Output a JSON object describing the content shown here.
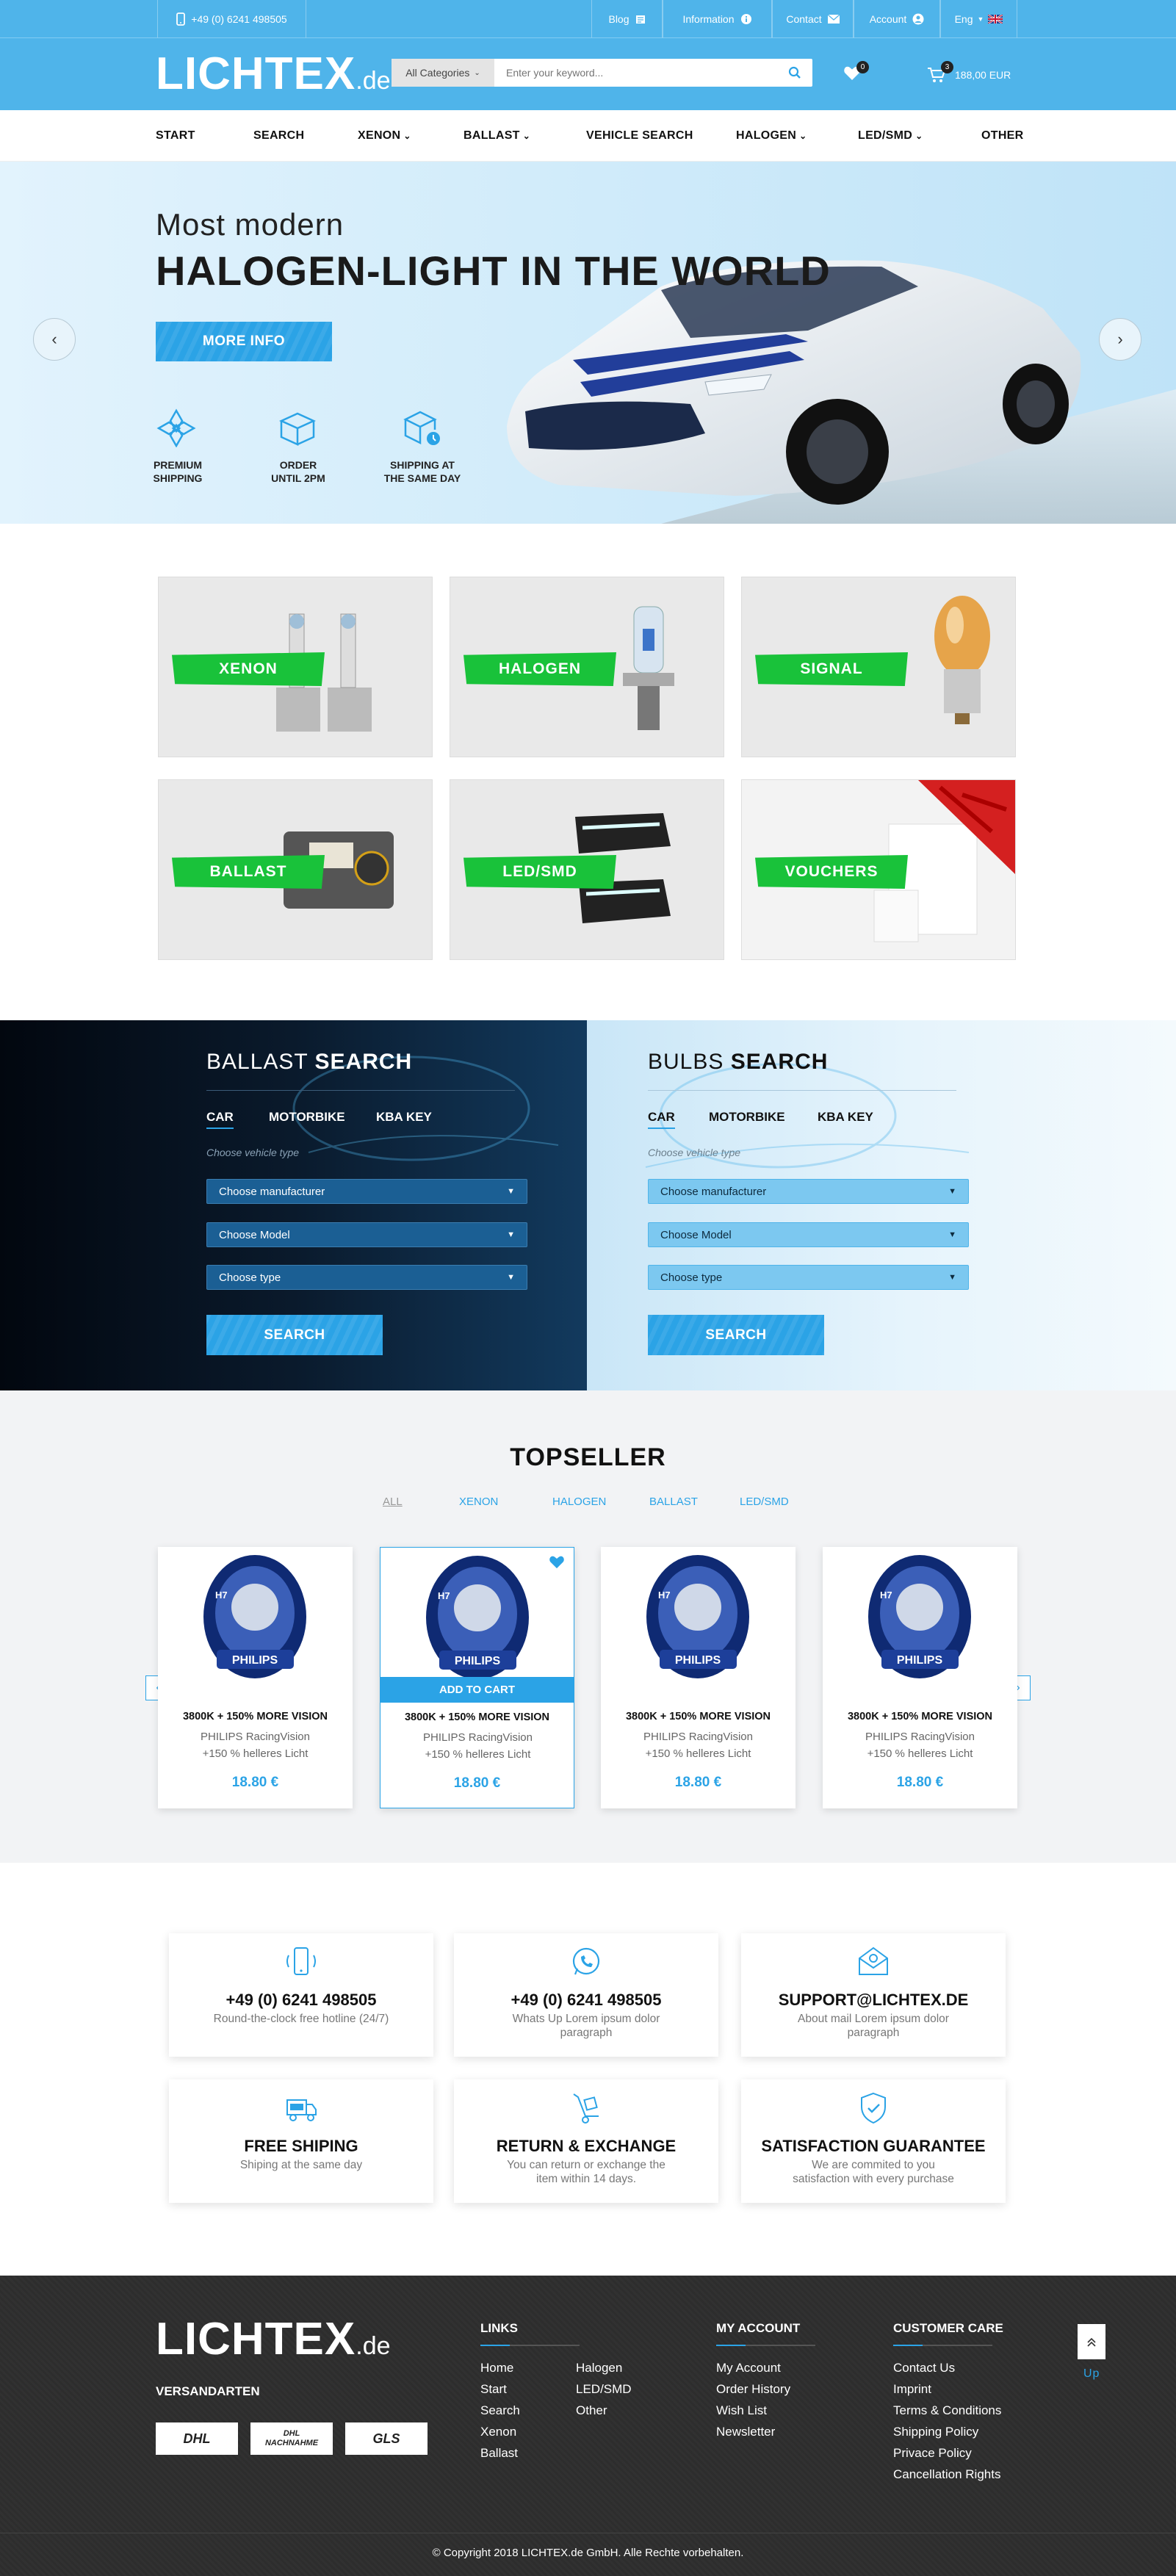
{
  "topbar": {
    "phone": "+49 (0) 6241 498505",
    "blog": "Blog",
    "information": "Information",
    "contact": "Contact",
    "account": "Account",
    "language": "Eng"
  },
  "header": {
    "logo_main": "LICHTEX",
    "logo_suffix": ".de",
    "category": "All Categories",
    "search_placeholder": "Enter your keyword...",
    "wishlist_count": "0",
    "cart_count": "3",
    "cart_total": "188,00 EUR"
  },
  "nav": [
    "START",
    "SEARCH",
    "XENON",
    "BALLAST",
    "VEHICLE SEARCH",
    "HALOGEN",
    "LED/SMD",
    "OTHER"
  ],
  "hero": {
    "line1": "Most modern",
    "line2": "HALOGEN-LIGHT IN THE WORLD",
    "button": "MORE INFO",
    "features": [
      {
        "l1": "PREMIUM",
        "l2": "SHIPPING"
      },
      {
        "l1": "ORDER",
        "l2": "UNTIL 2PM"
      },
      {
        "l1": "SHIPPING AT",
        "l2": "THE SAME DAY"
      }
    ]
  },
  "categories": [
    "XENON",
    "HALOGEN",
    "SIGNAL",
    "BALLAST",
    "LED/SMD",
    "VOUCHERS"
  ],
  "ballast_search": {
    "title_light": "BALLAST",
    "title_bold": "SEARCH",
    "tabs": [
      "CAR",
      "MOTORBIKE",
      "KBA KEY"
    ],
    "hint": "Choose vehicle type",
    "selects": [
      "Choose manufacturer",
      "Choose Model",
      "Choose type"
    ],
    "button": "SEARCH"
  },
  "bulbs_search": {
    "title_light": "BULBS",
    "title_bold": "SEARCH",
    "tabs": [
      "CAR",
      "MOTORBIKE",
      "KBA KEY"
    ],
    "hint": "Choose vehicle type",
    "selects": [
      "Choose manufacturer",
      "Choose Model",
      "Choose type"
    ],
    "button": "SEARCH"
  },
  "topseller": {
    "title": "TOPSELLER",
    "filters": [
      "ALL",
      "XENON",
      "HALOGEN",
      "BALLAST",
      "LED/SMD"
    ],
    "add_to_cart": "ADD TO CART",
    "products": [
      {
        "title": "3800K + 150%  MORE VISION",
        "desc": "PHILIPS RacingVision +150 % helleres Licht",
        "price": "18.80 €"
      },
      {
        "title": "3800K + 150%  MORE VISION",
        "desc": "PHILIPS RacingVision +150 % helleres Licht",
        "price": "18.80 €"
      },
      {
        "title": "3800K + 150%  MORE VISION",
        "desc": "PHILIPS RacingVision +150 % helleres Licht",
        "price": "18.80 €"
      },
      {
        "title": "3800K + 150%  MORE VISION",
        "desc": "PHILIPS RacingVision +150 % helleres Licht",
        "price": "18.80 €"
      }
    ],
    "pack_label": "PHILIPS",
    "pack_type": "H7"
  },
  "info": [
    {
      "icon": "phone-icon",
      "title": "+49 (0) 6241 498505",
      "sub": "Round-the-clock free hotline (24/7)"
    },
    {
      "icon": "whatsapp-icon",
      "title": "+49 (0) 6241 498505",
      "sub": "Whats Up Lorem ipsum dolor paragraph"
    },
    {
      "icon": "mail-icon",
      "title": "SUPPORT@LICHTEX.DE",
      "sub": "About mail Lorem ipsum dolor paragraph"
    },
    {
      "icon": "truck-icon",
      "title": "FREE SHIPING",
      "sub": "Shiping at the same day"
    },
    {
      "icon": "handtruck-icon",
      "title": "RETURN & EXCHANGE",
      "sub": "You can return or exchange the item within 14 days."
    },
    {
      "icon": "shield-icon",
      "title": "SATISFACTION GUARANTEE",
      "sub": "We are commited to you satisfaction with every purchase"
    }
  ],
  "footer": {
    "logo_main": "LICHTEX",
    "logo_suffix": ".de",
    "versand": "VERSANDARTEN",
    "shipping": [
      "DHL",
      "DHL NACHNAHME",
      "GLS"
    ],
    "links_title": "LINKS",
    "links_col1": [
      "Home",
      "Start",
      "Search",
      "Xenon",
      "Ballast"
    ],
    "links_col2": [
      "Halogen",
      "LED/SMD",
      "Other"
    ],
    "account_title": "MY ACCOUNT",
    "account": [
      "My Account",
      "Order History",
      "Wish List",
      "Newsletter"
    ],
    "care_title": "CUSTOMER CARE",
    "care": [
      "Contact Us",
      "Imprint",
      "Terms & Conditions",
      "Shipping Policy",
      "Privace Policy",
      "Cancellation Rights"
    ],
    "up": "Up",
    "copyright": "© Copyright 2018 LICHTEX.de GmbH. Alle Rechte vorbehalten."
  },
  "colors": {
    "brand": "#4fb4ea",
    "accent": "#2ba3e6",
    "category_label": "#19c23a",
    "footer_bg": "#2e2e2e"
  }
}
